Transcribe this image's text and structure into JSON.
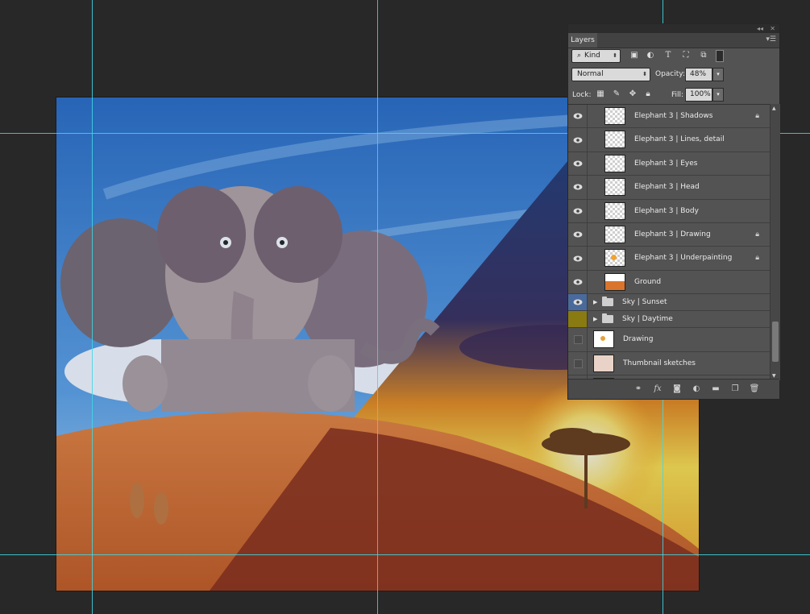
{
  "panel": {
    "tab_label": "Layers",
    "filter_kind": "Kind",
    "blend_mode": "Normal",
    "opacity_label": "Opacity:",
    "opacity_value": "48%",
    "lock_label": "Lock:",
    "fill_label": "Fill:",
    "fill_value": "100%"
  },
  "layers": [
    {
      "name": "Elephant 3 | Shadows",
      "visible": true,
      "locked": true,
      "type": "layer"
    },
    {
      "name": "Elephant 3 | Lines, detail",
      "visible": true,
      "locked": false,
      "type": "layer"
    },
    {
      "name": "Elephant 3 | Eyes",
      "visible": true,
      "locked": false,
      "type": "layer"
    },
    {
      "name": "Elephant 3 | Head",
      "visible": true,
      "locked": false,
      "type": "layer"
    },
    {
      "name": "Elephant 3 | Body",
      "visible": true,
      "locked": false,
      "type": "layer"
    },
    {
      "name": "Elephant 3 | Drawing",
      "visible": true,
      "locked": true,
      "type": "layer"
    },
    {
      "name": "Elephant 3 | Underpainting",
      "visible": true,
      "locked": true,
      "type": "layer"
    },
    {
      "name": "Ground",
      "visible": true,
      "locked": false,
      "type": "layer"
    },
    {
      "name": "Sky | Sunset",
      "visible": true,
      "locked": false,
      "type": "group",
      "color": "#4a6a9c"
    },
    {
      "name": "Sky | Daytime",
      "visible": false,
      "locked": false,
      "type": "group",
      "color": "#8a7a12"
    },
    {
      "name": "Drawing",
      "visible": false,
      "locked": false,
      "type": "layer"
    },
    {
      "name": "Thumbnail sketches",
      "visible": false,
      "locked": false,
      "type": "layer"
    }
  ],
  "icons": {
    "panel_collapse": "double-chevron-left-icon",
    "panel_close": "close-icon",
    "panel_menu": "panel-menu-icon",
    "filter_search": "search-icon",
    "filter_pixel": "image-filter-icon",
    "filter_adjust": "adjustment-filter-icon",
    "filter_type": "type-filter-icon",
    "filter_shape": "shape-filter-icon",
    "filter_smart": "smart-object-filter-icon",
    "filter_toggle": "filter-toggle-icon",
    "lock_transparent": "lock-transparent-pixels-icon",
    "lock_image": "lock-image-pixels-icon",
    "lock_position": "lock-position-icon",
    "lock_all": "lock-all-icon",
    "link": "link-layers-icon",
    "fx": "layer-style-icon",
    "mask": "add-mask-icon",
    "adjust": "new-adjustment-layer-icon",
    "group": "new-group-icon",
    "new": "new-layer-icon",
    "delete": "delete-layer-icon"
  },
  "colors": {
    "guide": "#3fd8e8",
    "panel_bg": "#535353",
    "sunset_label": "#4a6a9c",
    "daytime_label": "#8a7a12"
  }
}
